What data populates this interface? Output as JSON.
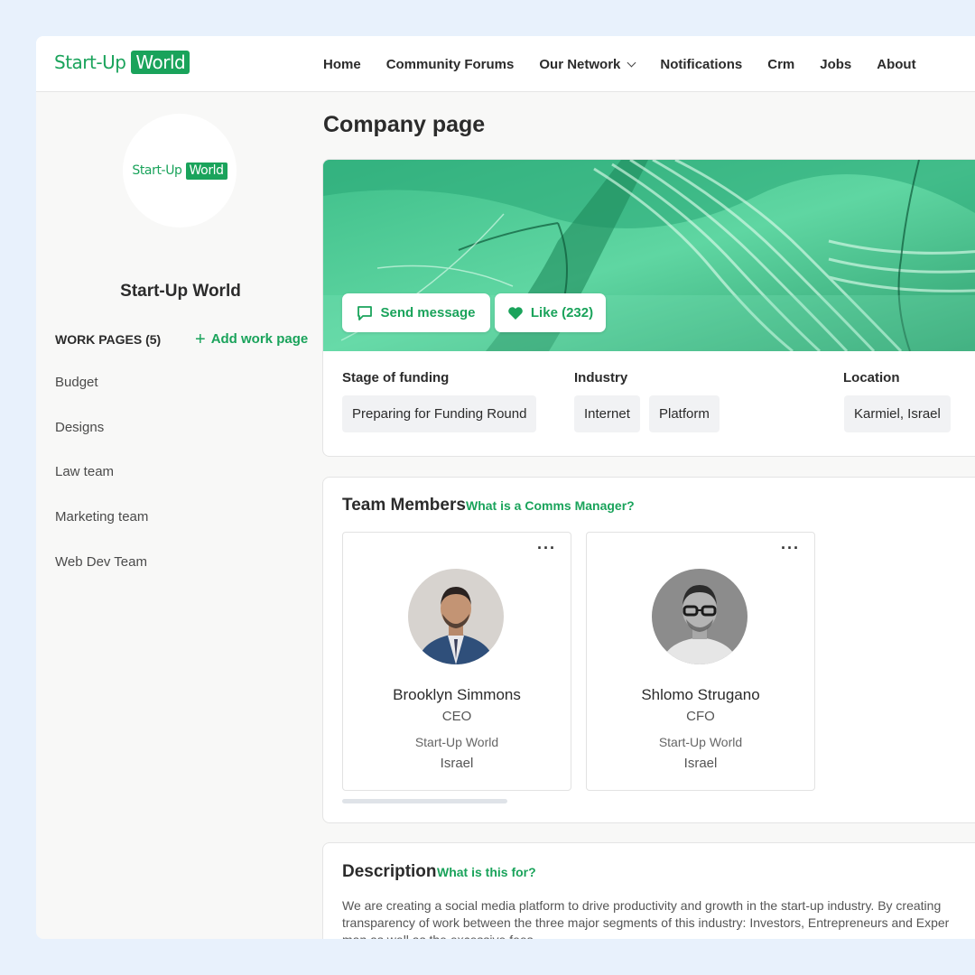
{
  "brand": {
    "name_part1": "Start-Up",
    "name_part2": "World",
    "accent": "#1aa35b"
  },
  "nav": {
    "items": [
      {
        "label": "Home"
      },
      {
        "label": "Community Forums"
      },
      {
        "label": "Our Network",
        "has_dropdown": true
      },
      {
        "label": "Notifications"
      },
      {
        "label": "Crm"
      },
      {
        "label": "Jobs"
      },
      {
        "label": "About"
      }
    ]
  },
  "sidebar": {
    "company_name": "Start-Up World",
    "work_pages_header": "WORK PAGES (5)",
    "add_work_page": "Add work page",
    "work_pages": [
      "Budget",
      "Designs",
      "Law team",
      "Marketing team",
      "Web Dev Team"
    ]
  },
  "main": {
    "page_title": "Company page",
    "send_message": "Send message",
    "like": "Like (232)",
    "stage_label": "Stage of funding",
    "stage_value": "Preparing for Funding Round",
    "industry_label": "Industry",
    "industry_values": [
      "Internet",
      "Platform"
    ],
    "location_label": "Location",
    "location_value": "Karmiel, Israel"
  },
  "team": {
    "title": "Team Members",
    "help_link": "What is a Comms Manager?",
    "members": [
      {
        "name": "Brooklyn Simmons",
        "role": "CEO",
        "company": "Start-Up World",
        "country": "Israel"
      },
      {
        "name": "Shlomo Strugano",
        "role": "CFO",
        "company": "Start-Up World",
        "country": "Israel"
      }
    ]
  },
  "description": {
    "title": "Description",
    "help_link": "What is this for?",
    "line1": "We are creating a social media platform to drive productivity and growth in the start-up industry. By creating",
    "line2": "transparency of work between the three major segments of this industry: Investors, Entrepreneurs and Exper",
    "line3": "man as well as the excessive fees."
  }
}
